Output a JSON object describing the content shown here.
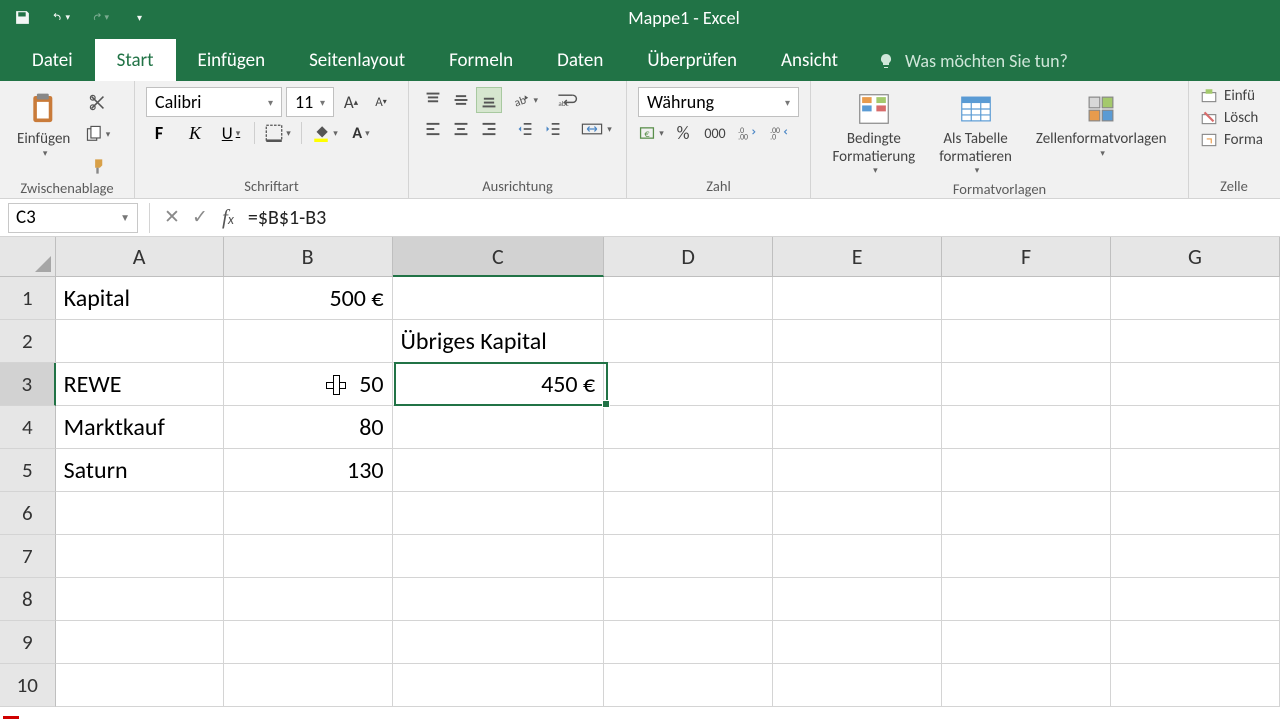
{
  "app": {
    "title": "Mappe1 - Excel"
  },
  "tabs": {
    "file": "Datei",
    "items": [
      "Start",
      "Einfügen",
      "Seitenlayout",
      "Formeln",
      "Daten",
      "Überprüfen",
      "Ansicht"
    ],
    "active": "Start",
    "tellme": "Was möchten Sie tun?"
  },
  "ribbon": {
    "clipboard": {
      "paste": "Einfügen",
      "label": "Zwischenablage"
    },
    "font": {
      "name": "Calibri",
      "size": "11",
      "label": "Schriftart"
    },
    "align": {
      "label": "Ausrichtung"
    },
    "number": {
      "format": "Währung",
      "label": "Zahl"
    },
    "styles": {
      "cond": "Bedingte\nFormatierung",
      "table": "Als Tabelle\nformatieren",
      "cell": "Zellenformatvorlagen",
      "label": "Formatvorlagen"
    },
    "cells": {
      "insert": "Einfü",
      "delete": "Lösch",
      "format": "Forma",
      "label": "Zelle"
    }
  },
  "namebox": "C3",
  "formula": "=$B$1-B3",
  "columns": [
    "A",
    "B",
    "C",
    "D",
    "E",
    "F",
    "G"
  ],
  "rows": [
    "1",
    "2",
    "3",
    "4",
    "5",
    "6",
    "7",
    "8",
    "9",
    "10"
  ],
  "data": {
    "A1": "Kapital",
    "B1": "500 €",
    "C2": "Übriges Kapital",
    "A3": "REWE",
    "B3": "50",
    "C3": "450 €",
    "A4": "Marktkauf",
    "B4": "80",
    "A5": "Saturn",
    "B5": "130"
  },
  "selected": {
    "col": "C",
    "row": "3"
  }
}
